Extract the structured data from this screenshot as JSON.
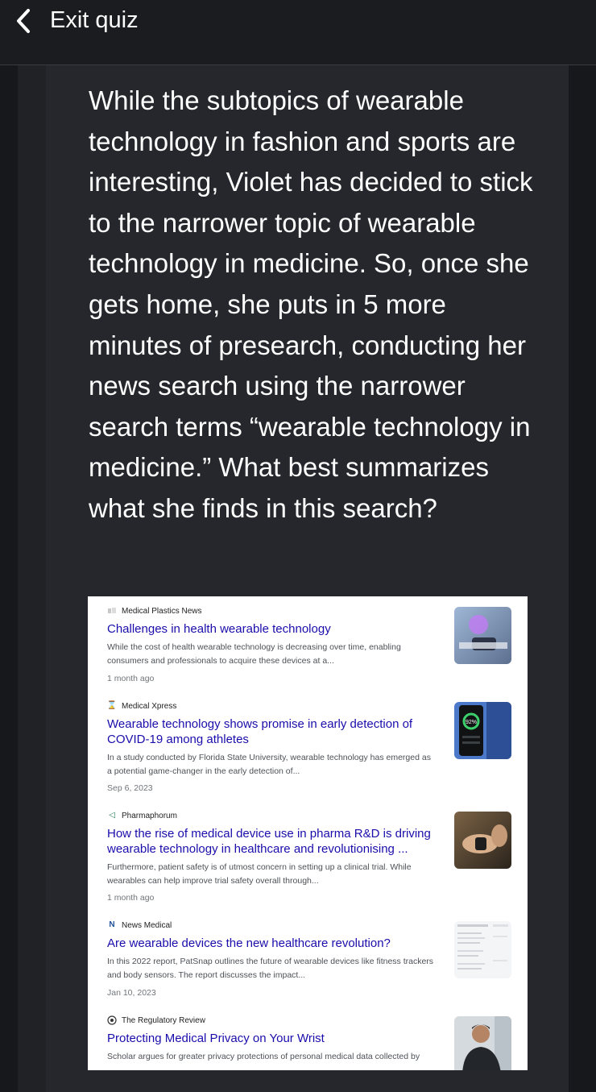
{
  "header": {
    "back_icon": "chevron-left-icon",
    "exit_label": "Exit quiz"
  },
  "question": {
    "text": "While the subtopics of wearable technology in fashion and sports are interesting, Violet has decided to stick to the narrower topic of wearable technology in medicine. So, once she gets home, she puts in 5 more minutes of presearch, conducting her news search using the narrower search terms “wearable technology in medicine.” What best summarizes what she finds in this search?"
  },
  "results": [
    {
      "source": "Medical Plastics News",
      "source_icon": "medical-plastics-news-logo",
      "title": "Challenges in health wearable technology",
      "snippet_line1": "While the cost of health wearable technology is decreasing over time, enabling",
      "snippet_line2": "consumers and professionals to acquire these devices at a...",
      "date": "1 month ago",
      "thumb": "smartwatch-photo"
    },
    {
      "source": "Medical Xpress",
      "source_icon": "medical-xpress-logo",
      "title_line1": "Wearable technology shows promise in early detection of",
      "title_line2": "COVID-19 among athletes",
      "snippet_line1": "In a study conducted by Florida State University, wearable technology has emerged as",
      "snippet_line2": "a potential game-changer in the early detection of...",
      "date": "Sep 6, 2023",
      "thumb": "fitness-app-phone-photo",
      "thumb_text": "92%"
    },
    {
      "source": "Pharmaphorum",
      "source_icon": "pharmaphorum-logo",
      "title_line1": "How the rise of medical device use in pharma R&D is driving",
      "title_line2": "wearable technology in healthcare and revolutionising ...",
      "snippet_line1": "Furthermore, patient safety is of utmost concern in setting up a clinical trial. While",
      "snippet_line2": "wearables can help improve trial safety overall through...",
      "date": "1 month ago",
      "thumb": "wrist-device-photo"
    },
    {
      "source": "News Medical",
      "source_icon": "news-medical-logo",
      "title": "Are wearable devices the new healthcare revolution?",
      "snippet_line1": "In this 2022 report, PatSnap outlines the future of wearable devices like fitness trackers",
      "snippet_line2": "and body sensors. The report discusses the impact...",
      "date": "Jan 10, 2023",
      "thumb": "report-document-thumbnail"
    },
    {
      "source": "The Regulatory Review",
      "source_icon": "regulatory-review-logo",
      "title": "Protecting Medical Privacy on Your Wrist",
      "snippet_line1": "Scholar argues for greater privacy protections of personal medical data collected by",
      "thumb": "person-with-smartwatch-photo"
    }
  ],
  "colors": {
    "background": "#17181c",
    "card": "#26272c",
    "link": "#1a0dab",
    "snippet": "#4d5156",
    "date": "#70757a"
  }
}
